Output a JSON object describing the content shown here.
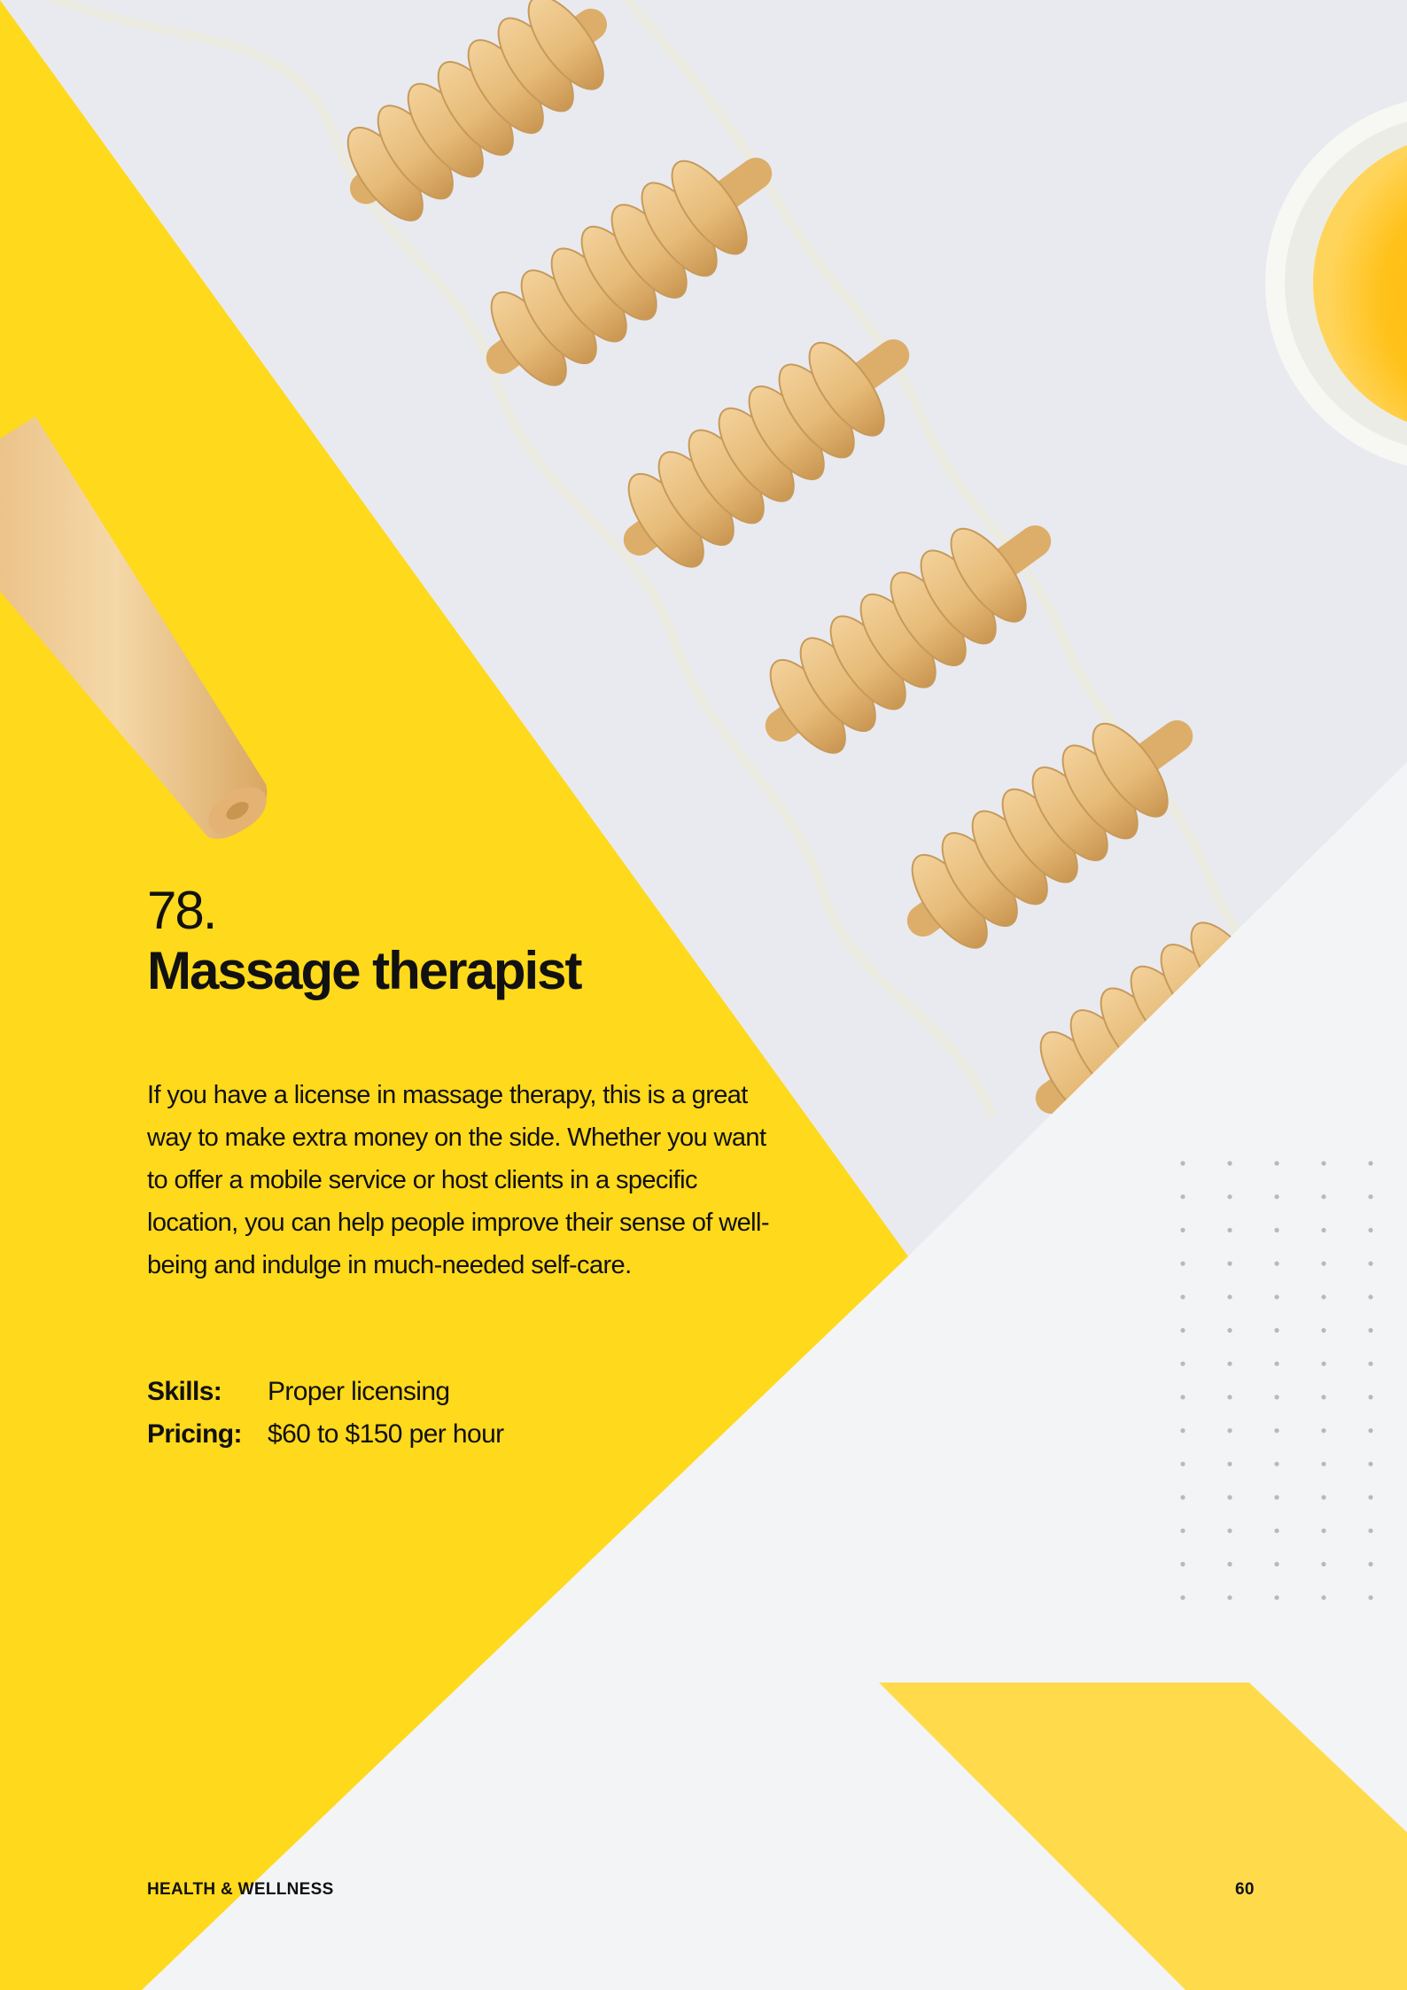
{
  "colors": {
    "accent_yellow": "#ffd91b",
    "light_yellow": "#ffdb4c",
    "background": "#f3f4f6",
    "photo_background": "#e9eaf0",
    "wood": "#e8bf7f",
    "rope": "#ecebe2",
    "text": "#111111",
    "dots": "#b8b9bc"
  },
  "icons": {
    "photo": "wooden-massage-roller-photo",
    "pattern": "dot-grid-decoration"
  },
  "entry": {
    "number": "78.",
    "title": "Massage therapist",
    "description": "If you have a license in massage therapy, this is a great way to make extra money on the side. Whether you want to offer a mobile service or host clients in a specific location, you can help people improve their sense of well-being and indulge in much-needed self-care."
  },
  "details": [
    {
      "label": "Skills:",
      "value": "Proper licensing"
    },
    {
      "label": "Pricing:",
      "value": "$60 to $150 per hour"
    }
  ],
  "footer": {
    "section": "HEALTH & WELLNESS",
    "page_number": "60"
  }
}
